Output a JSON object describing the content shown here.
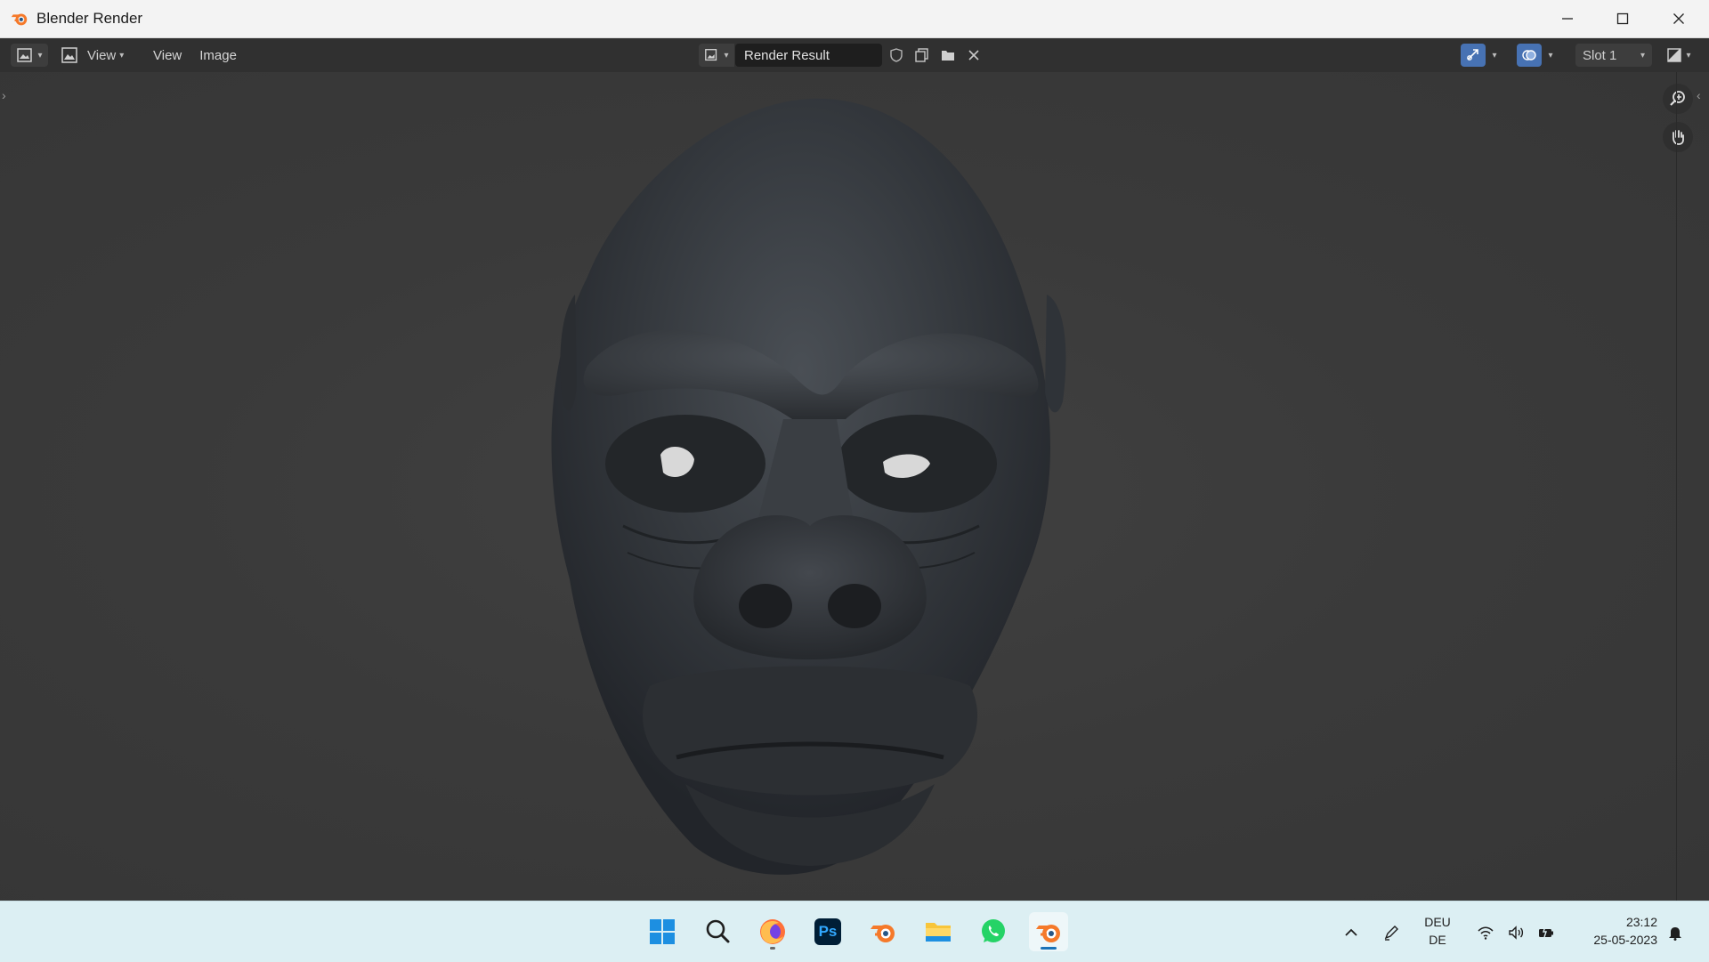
{
  "window": {
    "title": "Blender Render",
    "controls": [
      "minimize",
      "maximize",
      "close"
    ]
  },
  "header": {
    "editor_type_icon": "image-editor-icon",
    "view_mode_icon": "image-view-icon",
    "view_mode_label": "View",
    "menus": [
      "View",
      "Image"
    ],
    "image_browse_icon": "image-browse-icon",
    "image_name": "Render Result",
    "image_actions": [
      "fake-user-icon",
      "new-image-icon",
      "open-image-icon",
      "unlink-icon"
    ],
    "overlay_icon": "overlay-icon",
    "gizmo_icon": "gizmo-icon",
    "slot_label": "Slot 1",
    "display_channels_icon": "display-channels-icon"
  },
  "viewport": {
    "content": "gorilla-face-sculpt-render",
    "nav_tools": [
      "zoom-icon",
      "pan-hand-icon"
    ]
  },
  "taskbar": {
    "apps": [
      "windows-start-icon",
      "search-icon",
      "firefox-icon",
      "photoshop-icon",
      "blender-icon",
      "file-explorer-icon",
      "whatsapp-icon",
      "blender-active-icon"
    ],
    "photoshop_label": "Ps",
    "tray": {
      "language_line1": "DEU",
      "language_line2": "DE",
      "time": "23:12",
      "date": "25-05-2023"
    }
  },
  "colors": {
    "header_bg": "#303030",
    "viewport_bg": "#3a3a3a",
    "taskbar_bg": "#dceff3",
    "accent_blue": "#4772b3",
    "blender_orange": "#f5792a"
  }
}
